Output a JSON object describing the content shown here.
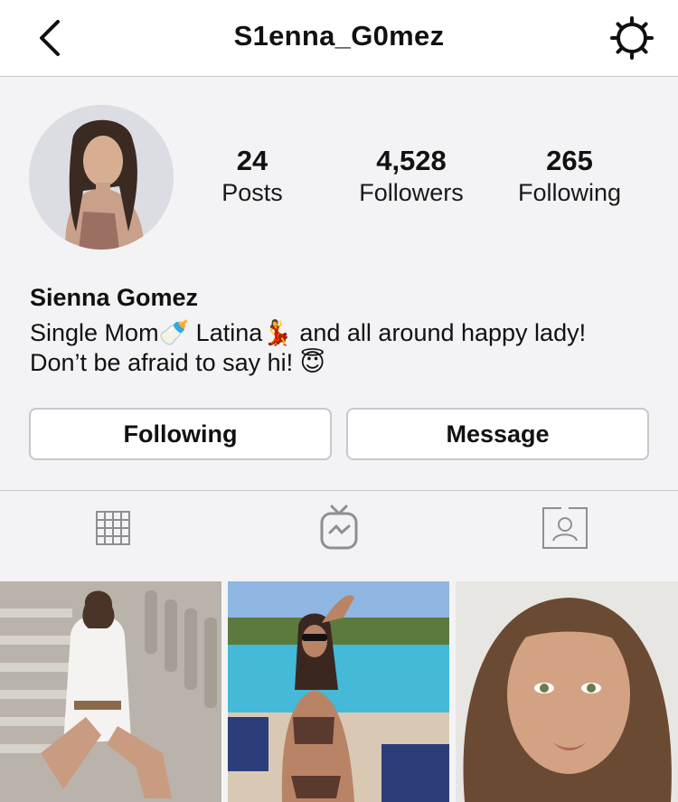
{
  "header": {
    "username": "S1enna_G0mez",
    "back_icon": "chevron-left-icon",
    "settings_icon": "gear-icon"
  },
  "profile": {
    "full_name": "Sienna Gomez",
    "bio_line1": "Single Mom🍼 Latina💃 and all around happy lady!",
    "bio_line2": "Don’t be afraid to say hi! 😇",
    "stats": [
      {
        "value": "24",
        "label": "Posts"
      },
      {
        "value": "4,528",
        "label": "Followers"
      },
      {
        "value": "265",
        "label": "Following"
      }
    ]
  },
  "actions": {
    "following_label": "Following",
    "message_label": "Message"
  },
  "tabs": [
    {
      "icon": "grid-icon"
    },
    {
      "icon": "igtv-icon"
    },
    {
      "icon": "tagged-icon"
    }
  ],
  "colors": {
    "background": "#f3f3f5",
    "border": "#c7c7cc",
    "icon_gray": "#8e8e93"
  }
}
